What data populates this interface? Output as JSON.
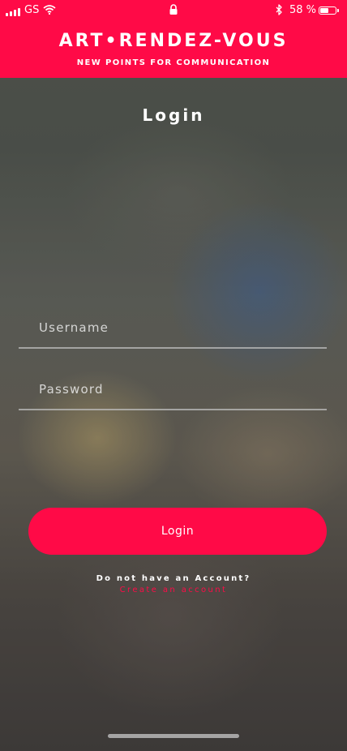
{
  "status_bar": {
    "carrier": "GS",
    "battery_text": "58 %",
    "battery_level": 0.58
  },
  "header": {
    "title": "ART•RENDEZ-VOUS",
    "subtitle": "NEW POINTS FOR COMMUNICATION"
  },
  "page": {
    "title": "Login"
  },
  "form": {
    "username_placeholder": "Username",
    "username_value": "",
    "password_placeholder": "Password",
    "password_value": "",
    "login_label": "Login"
  },
  "signup": {
    "prompt": "Do not have an Account?",
    "link_label": "Create an account"
  },
  "colors": {
    "accent": "#ff0a47",
    "text": "#ffffff"
  }
}
